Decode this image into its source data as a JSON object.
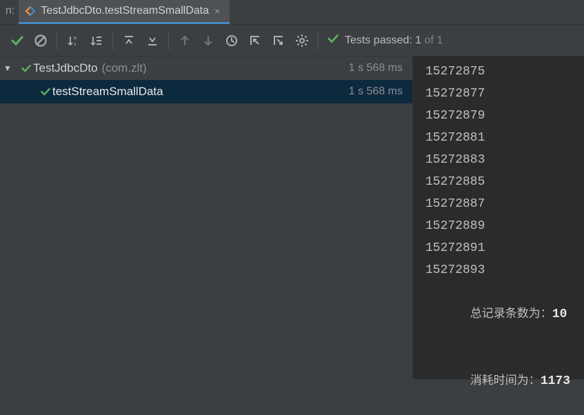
{
  "tab": {
    "prefix": "n:",
    "title": "TestJdbcDto.testStreamSmallData",
    "close": "×"
  },
  "status": {
    "prefix": "Tests passed:",
    "passed": "1",
    "of_word": "of",
    "total": "1"
  },
  "tree": {
    "root": {
      "name": "TestJdbcDto",
      "pkg": "(com.zlt)",
      "duration": "1 s 568 ms"
    },
    "child": {
      "name": "testStreamSmallData",
      "duration": "1 s 568 ms"
    }
  },
  "console": {
    "numbers": [
      "15272875",
      "15272877",
      "15272879",
      "15272881",
      "15272883",
      "15272885",
      "15272887",
      "15272889",
      "15272891",
      "15272893"
    ],
    "total_label": "总记录条数为：",
    "total_value": "10",
    "time_label": "消耗时间为：",
    "time_value": "1173"
  },
  "icons": {
    "check": "check",
    "forbid": "forbid",
    "sort": "sort",
    "collapse": "collapse",
    "expand_top": "expand-top",
    "expand_bottom": "expand-bottom",
    "arrow_up": "arrow-up",
    "arrow_down": "arrow-down",
    "history": "history",
    "import": "import",
    "export": "export",
    "gear": "gear"
  }
}
